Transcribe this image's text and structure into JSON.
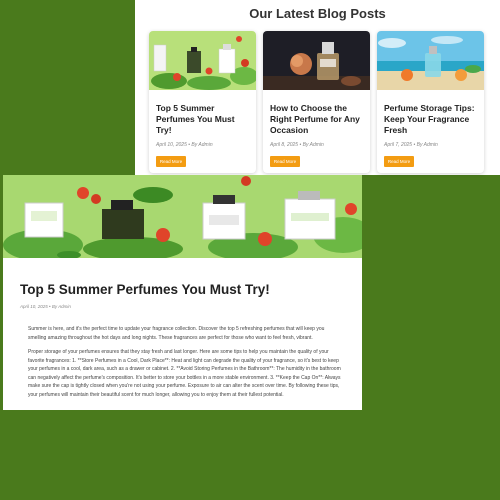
{
  "section": {
    "title": "Our Latest Blog Posts"
  },
  "cards": [
    {
      "title": "Top 5 Summer Perfumes You Must Try!",
      "meta": "April 10, 2025 • By Admin",
      "button": "Read More"
    },
    {
      "title": "How to Choose the Right Perfume for Any Occasion",
      "meta": "April 8, 2025 • By Admin",
      "button": "Read More"
    },
    {
      "title": "Perfume Storage Tips: Keep Your Fragrance Fresh",
      "meta": "April 7, 2025 • By Admin",
      "button": "Read More"
    }
  ],
  "article": {
    "title": "Top 5 Summer Perfumes You Must Try!",
    "meta": "April 10, 2025 • By Admin",
    "intro": "Summer is here, and it's the perfect time to update your fragrance collection. Discover the top 5 refreshing perfumes that will keep you smelling amazing throughout the hot days and long nights. These fragrances are perfect for those who want to feel fresh, vibrant.",
    "body": "Proper storage of your perfumes ensures that they stay fresh and last longer. Here are some tips to help you maintain the quality of your favorite fragrances: 1. **Store Perfumes in a Cool, Dark Place**: Heat and light can degrade the quality of your fragrance, so it's best to keep your perfumes in a cool, dark area, such as a drawer or cabinet. 2. **Avoid Storing Perfumes in the Bathroom**: The humidity in the bathroom can negatively affect the perfume's composition. It's better to store your bottles in a more stable environment. 3. **Keep the Cap On**: Always make sure the cap is tightly closed when you're not using your perfume. Exposure to air can alter the scent over time. By following these tips, your perfumes will maintain their beautiful scent for much longer, allowing you to enjoy them at their fullest potential."
  },
  "colors": {
    "background": "#4a7a1c",
    "accent": "#f39c12"
  }
}
